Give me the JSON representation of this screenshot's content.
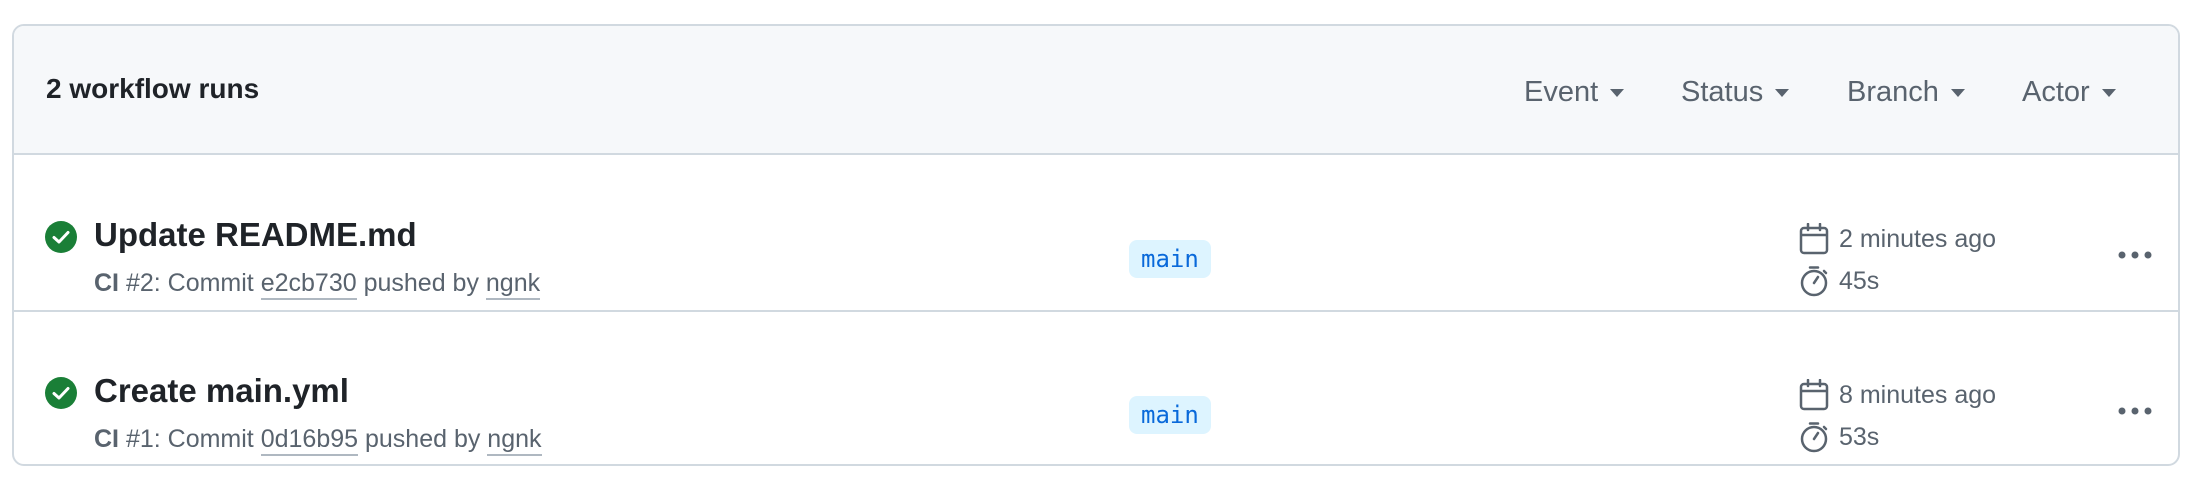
{
  "header": {
    "count_label": "2 workflow runs",
    "filters": [
      "Event",
      "Status",
      "Branch",
      "Actor"
    ]
  },
  "runs": [
    {
      "title": "Update README.md",
      "workflow": "CI",
      "meta_number": " #2: Commit ",
      "commit": "e2cb730",
      "pushed_by": " pushed by ",
      "actor": "ngnk",
      "branch": "main",
      "started": "2 minutes ago",
      "duration": "45s",
      "status": "success"
    },
    {
      "title": "Create main.yml",
      "workflow": "CI",
      "meta_number": " #1: Commit ",
      "commit": "0d16b95",
      "pushed_by": " pushed by ",
      "actor": "ngnk",
      "branch": "main",
      "started": "8 minutes ago",
      "duration": "53s",
      "status": "success"
    }
  ],
  "colors": {
    "success": "#1a7f37",
    "branch_bg": "#ddf4ff",
    "branch_fg": "#0969da",
    "muted": "#59636e"
  },
  "icons": {
    "status": "check-circle-fill-icon",
    "started": "calendar-icon",
    "duration": "stopwatch-icon",
    "more": "kebab-horizontal-icon"
  }
}
